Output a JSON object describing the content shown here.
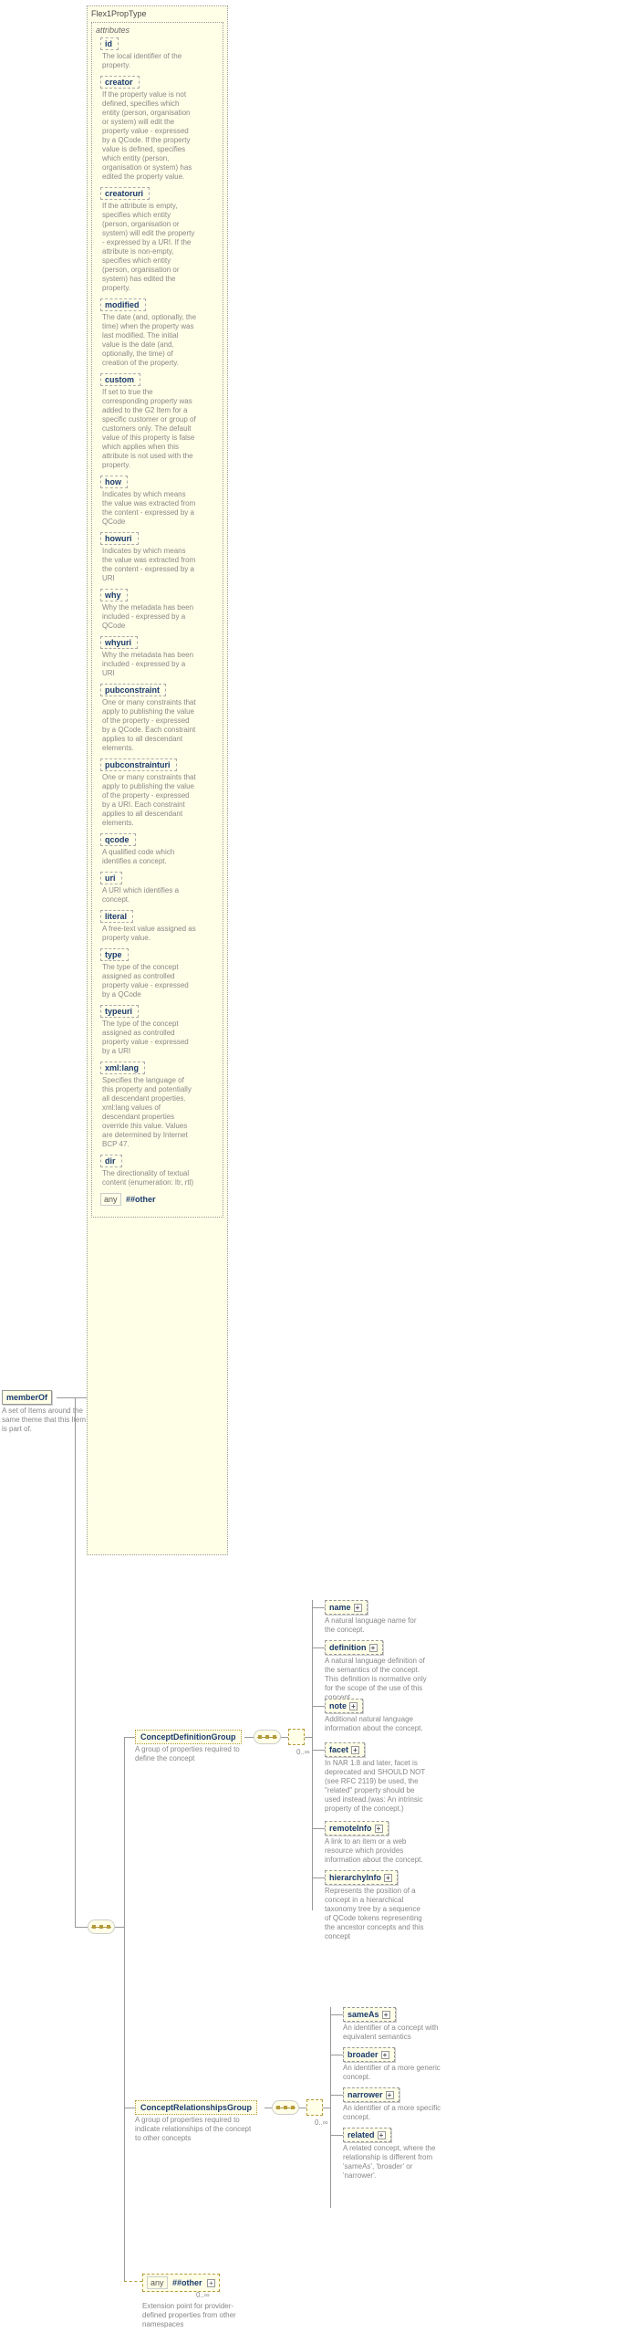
{
  "typeName": "Flex1PropType",
  "attributesLabel": "attributes",
  "memberOf": {
    "label": "memberOf",
    "desc": "A set of Items around the same theme that this Item is part of."
  },
  "attrs": [
    {
      "name": "id",
      "desc": "The local identifier of the property."
    },
    {
      "name": "creator",
      "desc": "If the property value is not defined, specifies which entity (person, organisation or system) will edit the property value - expressed by a QCode. If the property value is defined, specifies which entity (person, organisation or system) has edited the property value."
    },
    {
      "name": "creatoruri",
      "desc": "If the attribute is empty, specifies which entity (person, organisation or system) will edit the property - expressed by a URI. If the attribute is non-empty, specifies which entity (person, organisation or system) has edited the property."
    },
    {
      "name": "modified",
      "desc": "The date (and, optionally, the time) when the property was last modified. The initial value is the date (and, optionally, the time) of creation of the property."
    },
    {
      "name": "custom",
      "desc": "If set to true the corresponding property was added to the G2 Item for a specific customer or group of customers only. The default value of this property is false which applies when this attribute is not used with the property."
    },
    {
      "name": "how",
      "desc": "Indicates by which means the value was extracted from the content - expressed by a QCode"
    },
    {
      "name": "howuri",
      "desc": "Indicates by which means the value was extracted from the content - expressed by a URI"
    },
    {
      "name": "why",
      "desc": "Why the metadata has been included - expressed by a QCode"
    },
    {
      "name": "whyuri",
      "desc": "Why the metadata has been included - expressed by a URI"
    },
    {
      "name": "pubconstraint",
      "desc": "One or many constraints that apply to publishing the value of the property - expressed by a QCode. Each constraint applies to all descendant elements."
    },
    {
      "name": "pubconstrainturi",
      "desc": "One or many constraints that apply to publishing the value of the property - expressed by a URI. Each constraint applies to all descendant elements."
    },
    {
      "name": "qcode",
      "desc": "A qualified code which identifies a concept."
    },
    {
      "name": "uri",
      "desc": "A URI which identifies a concept."
    },
    {
      "name": "literal",
      "desc": "A free-text value assigned as property value."
    },
    {
      "name": "type",
      "desc": "The type of the concept assigned as controlled property value - expressed by a QCode"
    },
    {
      "name": "typeuri",
      "desc": "The type of the concept assigned as controlled property value - expressed by a URI"
    },
    {
      "name": "xml:lang",
      "desc": "Specifies the language of this property and potentially all descendant properties. xml:lang values of descendant properties override this value. Values are determined by Internet BCP 47."
    },
    {
      "name": "dir",
      "desc": "The directionality of textual content (enumeration: ltr, rtl)"
    }
  ],
  "anyOther": "##other",
  "anyLabel": "any",
  "groups": {
    "def": {
      "label": "ConceptDefinitionGroup",
      "desc": "A group of properties required to define the concept"
    },
    "rel": {
      "label": "ConceptRelationshipsGroup",
      "desc": "A group of properties required to indicate relationships of the concept to other concepts"
    },
    "ext": {
      "desc": "Extension point for provider-defined properties from other namespaces"
    }
  },
  "defElems": [
    {
      "name": "name",
      "desc": "A natural language name for the concept."
    },
    {
      "name": "definition",
      "desc": "A natural language definition of the semantics of the concept. This definition is normative only for the scope of the use of this concept."
    },
    {
      "name": "note",
      "desc": "Additional natural language information about the concept."
    },
    {
      "name": "facet",
      "desc": "In NAR 1.8 and later, facet is deprecated and SHOULD NOT (see RFC 2119) be used, the \"related\" property should be used instead.(was: An intrinsic property of the concept.)"
    },
    {
      "name": "remoteInfo",
      "desc": "A link to an item or a web resource which provides information about the concept."
    },
    {
      "name": "hierarchyInfo",
      "desc": "Represents the position of a concept in a hierarchical taxonomy tree by a sequence of QCode tokens representing the ancestor concepts and this concept"
    }
  ],
  "relElems": [
    {
      "name": "sameAs",
      "desc": "An identifier of a concept with equivalent semantics"
    },
    {
      "name": "broader",
      "desc": "An identifier of a more generic concept."
    },
    {
      "name": "narrower",
      "desc": "An identifier of a more specific concept."
    },
    {
      "name": "related",
      "desc": "A related concept, where the relationship is different from 'sameAs', 'broader' or 'narrower'."
    }
  ],
  "occ": "0..∞"
}
